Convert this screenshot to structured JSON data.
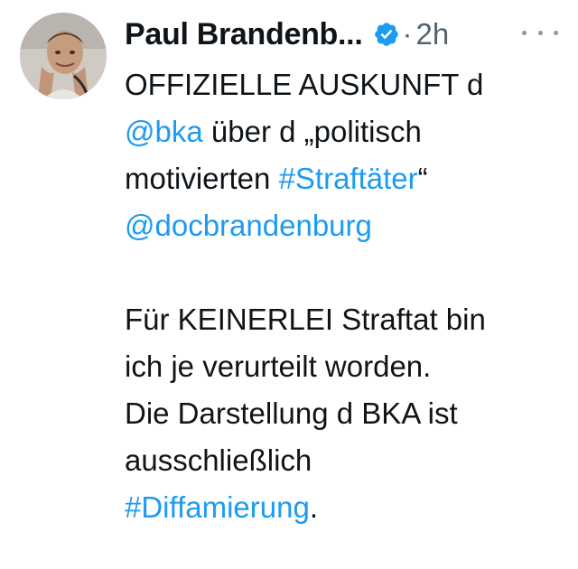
{
  "tweet": {
    "author_name": "Paul Brandenb...",
    "time_sep": "·",
    "time": "2h",
    "colors": {
      "link": "#1d9bf0",
      "verified": "#1d9bf0",
      "secondary": "#536471"
    },
    "icons": {
      "verified": "verified-badge-icon",
      "more": "more-horizontal-icon"
    },
    "lines": [
      {
        "text": "OFFIZIELLE AUSKUNFT d"
      },
      {
        "link1": "@bka",
        "text1": " über d „politisch"
      },
      {
        "text1": "motivierten ",
        "link1": "#Straftäter",
        "text2": "“"
      },
      {
        "link1": "@docbrandenburg"
      },
      {
        "text1": "Für KEINERLEI Straftat bin"
      },
      {
        "text1": "ich je verurteilt worden."
      },
      {
        "text1": "Die Darstellung d BKA ist"
      },
      {
        "text1": "ausschließlich"
      },
      {
        "link1": "#Diffamierung",
        "text2": "."
      }
    ]
  }
}
